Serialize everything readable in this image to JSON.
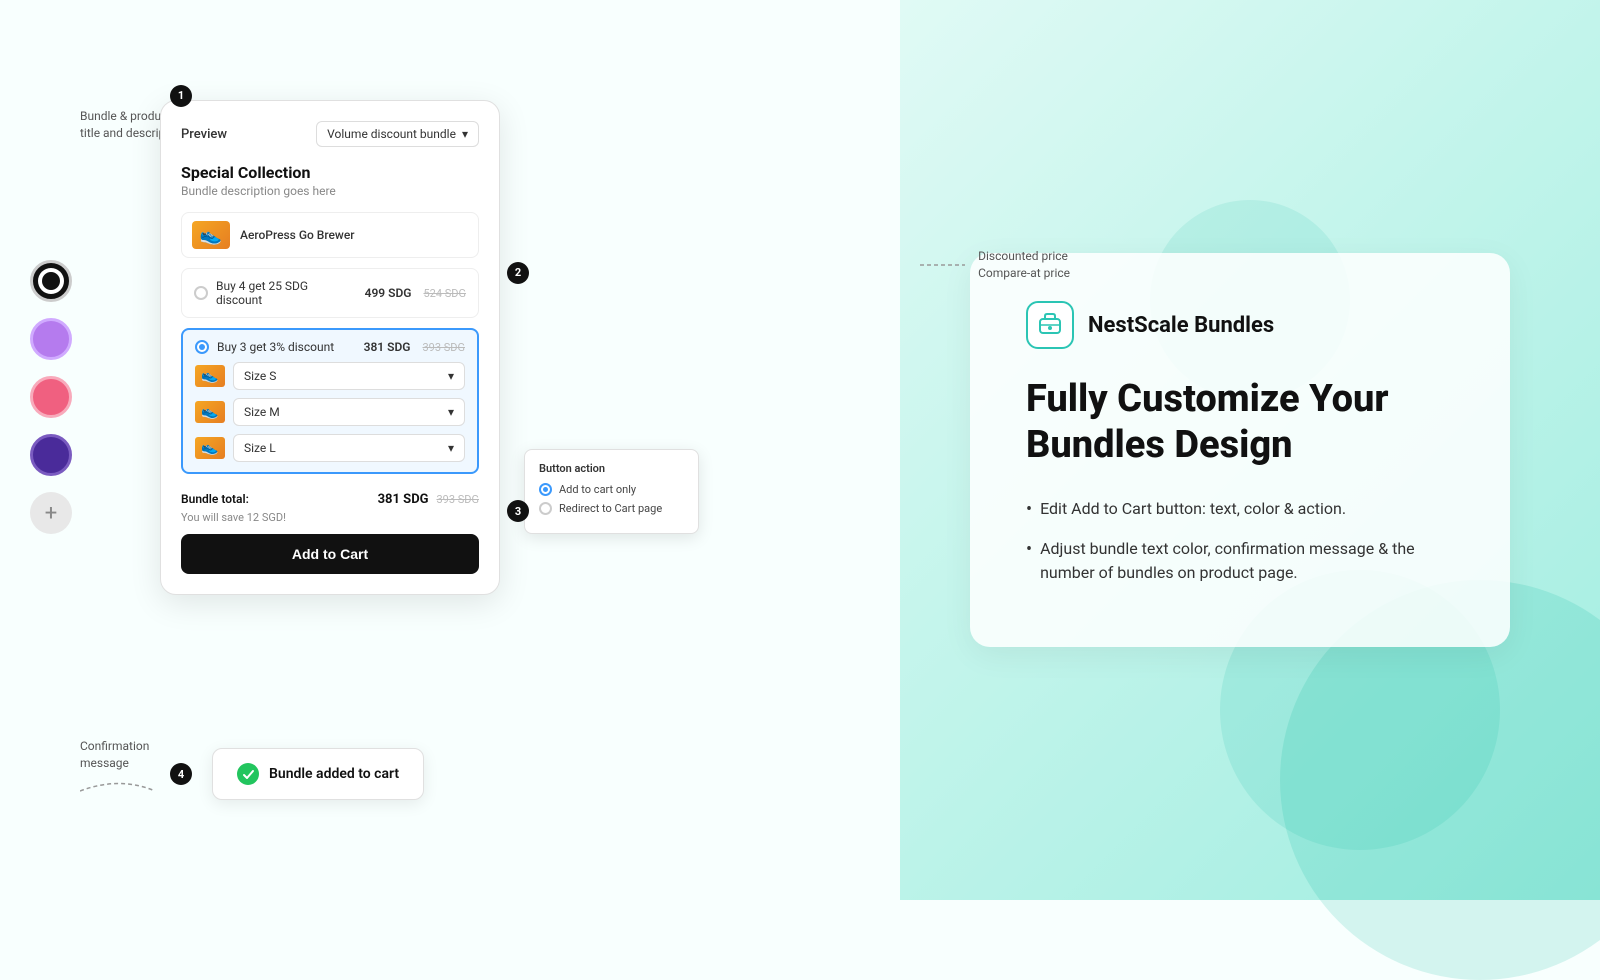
{
  "page": {
    "title": "NestScale Bundles - Fully Customize Your Bundles Design"
  },
  "background": {
    "gradient_start": "#e0faf5",
    "gradient_end": "#a0ede0"
  },
  "palette": {
    "colors": [
      "#111111",
      "#b57bee",
      "#f06080",
      "#4a2b9a"
    ],
    "add_label": "+"
  },
  "preview": {
    "label": "Preview",
    "bundle_type": "Volume discount bundle",
    "bundle_name": "Special Collection",
    "bundle_desc": "Bundle description goes here",
    "product_name": "AeroPress Go Brewer",
    "options": [
      {
        "label": "Buy 4 get 25 SDG discount",
        "price": "499 SDG",
        "original_price": "524 SDG",
        "selected": false
      },
      {
        "label": "Buy 3 get 3% discount",
        "price": "381 SDG",
        "original_price": "393 SDG",
        "selected": true,
        "sizes": [
          "Size S",
          "Size M",
          "Size L"
        ]
      }
    ],
    "total_label": "Bundle total:",
    "total_price": "381 SDG",
    "total_original": "393 SDG",
    "save_text": "You will save 12 SGD!",
    "add_to_cart_label": "Add to Cart"
  },
  "button_action_popup": {
    "title": "Button action",
    "options": [
      {
        "label": "Add to cart only",
        "selected": true
      },
      {
        "label": "Redirect to Cart page",
        "selected": false
      }
    ]
  },
  "confirmation": {
    "message": "Bundle added to cart"
  },
  "annotations": {
    "1": {
      "label": "Bundle & product\ntitle and description"
    },
    "2": {
      "label": "Discounted price\nCompare-at price"
    },
    "3": {
      "label": ""
    },
    "4": {
      "label": "Confirmation\nmessage"
    }
  },
  "brand": {
    "name": "NestScale Bundles",
    "logo_icon": "box-icon"
  },
  "info": {
    "heading_line1": "Fully Customize Your",
    "heading_line2": "Bundles Design",
    "features": [
      "Edit Add to Cart button: text, color & action.",
      "Adjust bundle text color, confirmation message & the number of bundles on product page."
    ]
  }
}
